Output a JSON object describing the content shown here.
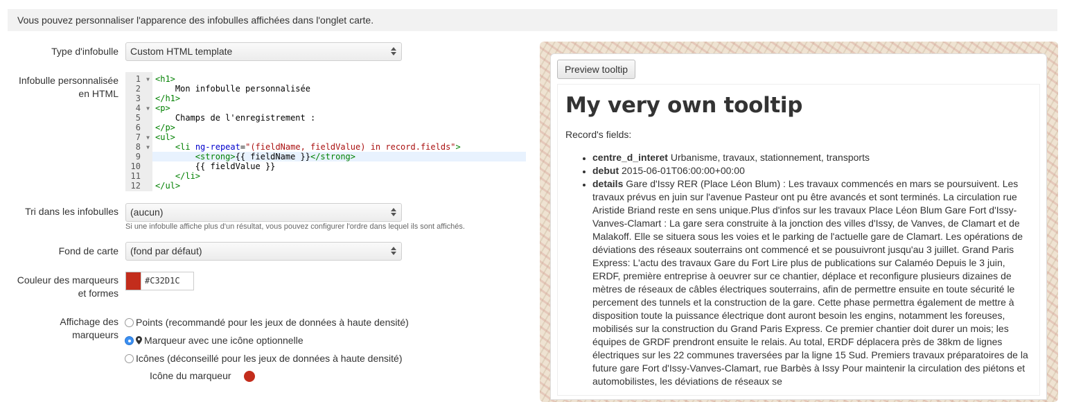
{
  "banner": "Vous pouvez personnaliser l'apparence des infobulles affichées dans l'onglet carte.",
  "form": {
    "tooltip_type_label": "Type d'infobulle",
    "tooltip_type_value": "Custom HTML template",
    "custom_html_label_1": "Infobulle personnalisée",
    "custom_html_label_2": "en HTML",
    "sort_label": "Tri dans les infobulles",
    "sort_value": "(aucun)",
    "sort_help": "Si une infobulle affiche plus d'un résultat, vous pouvez configurer l'ordre dans lequel ils sont affichés.",
    "basemap_label": "Fond de carte",
    "basemap_value": "(fond par défaut)",
    "color_label_1": "Couleur des marqueurs",
    "color_label_2": "et formes",
    "color_value": "#C32D1C",
    "display_label_1": "Affichage des",
    "display_label_2": "marqueurs",
    "display_options": [
      "Points (recommandé pour les jeux de données à haute densité)",
      "Marqueur avec une icône optionnelle",
      "Icônes (déconseillé pour les jeux de données à haute densité)"
    ],
    "marker_icon_label": "Icône du marqueur"
  },
  "editor": {
    "line_numbers": [
      "1",
      "2",
      "3",
      "4",
      "5",
      "6",
      "7",
      "8",
      "9",
      "10",
      "11",
      "12"
    ],
    "fold_markers": [
      true,
      false,
      false,
      true,
      false,
      false,
      true,
      true,
      false,
      false,
      false,
      false
    ],
    "active_line": 9
  },
  "preview": {
    "button_label": "Preview tooltip",
    "title": "My very own tooltip",
    "subtitle": "Record's fields:",
    "fields": [
      {
        "name": "centre_d_interet",
        "value": "Urbanisme, travaux, stationnement, transports"
      },
      {
        "name": "debut",
        "value": "2015-06-01T06:00:00+00:00"
      },
      {
        "name": "details",
        "value": "Gare d'Issy RER (Place Léon Blum) : Les travaux commencés en mars se poursuivent. Les travaux prévus en juin sur l'avenue Pasteur ont pu être avancés et sont terminés. La circulation rue Aristide Briand reste en sens unique.Plus d'infos sur les travaux Place Léon Blum    Gare Fort d'Issy-Vanves-Clamart : La gare sera construite à la jonction des villes d'Issy, de Vanves, de Clamart et de Malakoff. Elle se situera sous les voies et le parking de l'actuelle gare de Clamart. Les opérations de déviations des réseaux souterrains ont commencé et se pousuivront jusqu'au 3 juillet.       Grand Paris Express: L'actu des travaux Gare du Fort Lire plus de publications sur Calaméo       Depuis le 3 juin, ERDF, première entreprise à oeuvrer sur ce chantier, déplace et reconfigure plusieurs dizaines de mètres de réseaux de câbles électriques souterrains, afin de permettre ensuite en toute sécurité le percement des tunnels et la construction de la gare. Cette phase permettra également de mettre à disposition toute la puissance électrique dont auront besoin les engins, notamment les foreuses, mobilisés sur la construction du Grand Paris Express. Ce premier chantier doit durer un mois; les équipes de GRDF prendront ensuite le relais. Au total, ERDF déplacera près de 38km de lignes électriques sur les 22 communes traversées par la ligne 15 Sud.    Premiers travaux préparatoires de la future gare Fort d'Issy-Vanves-Clamart, rue Barbès à Issy    Pour maintenir la circulation des piétons et automobilistes, les déviations de réseaux se"
      }
    ]
  },
  "colors": {
    "marker": "#C32D1C",
    "radio_checked": "#3b8ff1"
  }
}
